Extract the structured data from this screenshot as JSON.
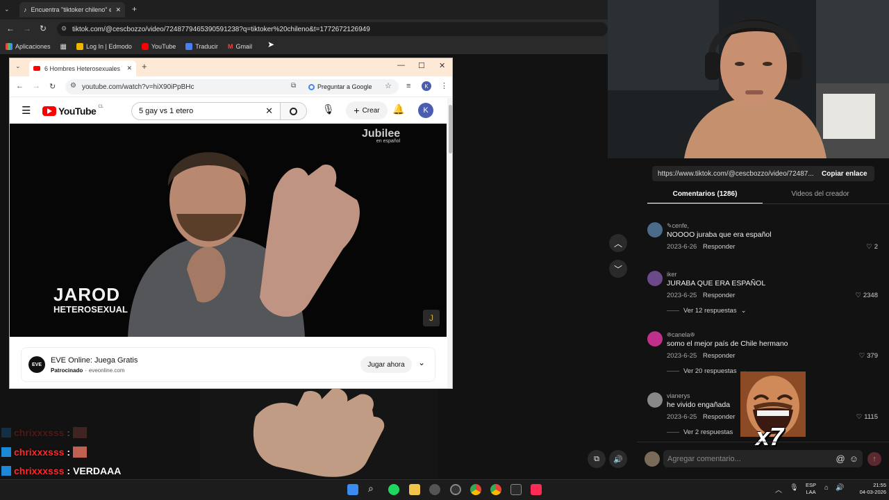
{
  "back_window": {
    "tab_title": "Encuentra \"tiktoker chileno\" en",
    "url": "tiktok.com/@cescbozzo/video/7248779465390591238?q=tiktoker%20chileno&t=1772672126949",
    "bookmarks": [
      "Aplicaciones",
      "Log In | Edmodo",
      "YouTube",
      "Traducir",
      "Gmail"
    ]
  },
  "yt_window": {
    "tab_title": "6 Hombres Heterosexuales VS",
    "url": "youtube.com/watch?v=hiX90iPpBHc",
    "ask_google": "Preguntar a Google",
    "profile_initial": "K",
    "logo_text": "YouTube",
    "logo_country": "CL",
    "search_value": "5 gay vs 1 etero",
    "create_label": "Crear",
    "avatar_initial": "K",
    "video": {
      "brand_line1": "Jubilee",
      "brand_line2": "en español",
      "name": "JAROD",
      "caption": "HETEROSEXUAL"
    },
    "ad": {
      "logo_text": "EVE",
      "title": "EVE Online: Juega Gratis",
      "sponsored": "Patrocinado",
      "domain": "eveonline.com",
      "cta": "Jugar ahora"
    }
  },
  "chat": [
    {
      "name": "chrixxxsss",
      "sep": ":",
      "msg": ""
    },
    {
      "name": "chrixxxsss",
      "sep": ":",
      "msg": ""
    },
    {
      "name": "chrixxxsss",
      "sep": ":",
      "msg": "VERDAAA"
    },
    {
      "name": "chrixxxsss",
      "sep": ":",
      "msg": ""
    }
  ],
  "tiktok": {
    "share_url": "https://www.tiktok.com/@cescbozzo/video/72487...",
    "copy_label": "Copiar enlace",
    "tab_comments": "Comentarios (1286)",
    "tab_creator": "Videos del creador",
    "reply_label": "Responder",
    "comments": [
      {
        "user": "✎cenfe,",
        "text": "NOOOO juraba que era español",
        "date": "2023-6-26",
        "likes": "2",
        "more": "",
        "avatar_color": "#4a6b8a"
      },
      {
        "user": "iker",
        "text": "JURABA QUE ERA ESPAÑOL",
        "date": "2023-6-25",
        "likes": "2348",
        "more": "Ver 12 respuestas",
        "avatar_color": "#6b4a8a"
      },
      {
        "user": "ꔮcanelaꔮ",
        "text": "somo el mejor país de Chile hermano",
        "date": "2023-6-25",
        "likes": "379",
        "more": "Ver 20 respuestas",
        "avatar_color": "#c0308a"
      },
      {
        "user": "vianerys",
        "text": "he vivido engañada",
        "date": "2023-6-25",
        "likes": "1115",
        "more": "Ver 2 respuestas",
        "avatar_color": "#888888"
      }
    ],
    "add_comment_placeholder": "Agregar comentario...",
    "emote_multiplier": "x7"
  },
  "taskbar": {
    "lang_line1": "ESP",
    "lang_line2": "LAA",
    "time": "21:55",
    "date": "04-03-2026"
  }
}
